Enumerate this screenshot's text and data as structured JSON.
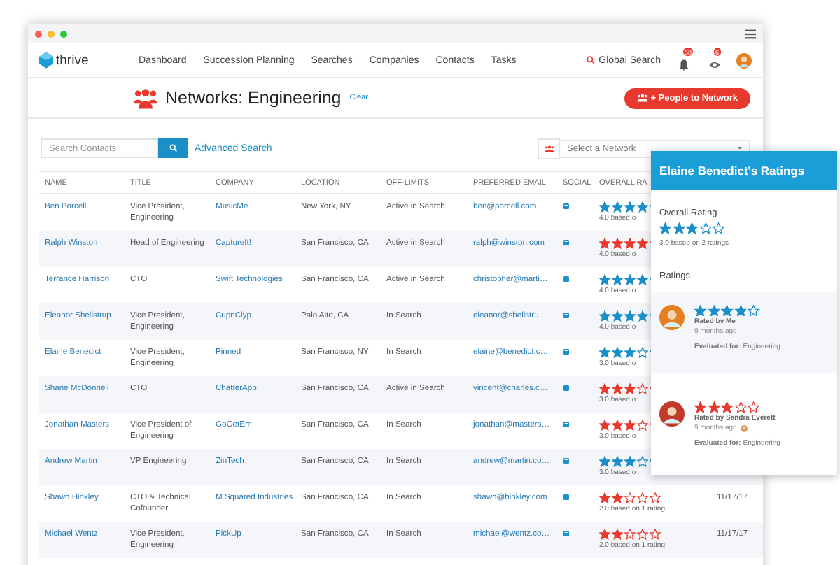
{
  "nav": {
    "logo": "thrive",
    "links": [
      "Dashboard",
      "Succession Planning",
      "Searches",
      "Companies",
      "Contacts",
      "Tasks"
    ],
    "global_search": "Global Search",
    "badges": [
      "58",
      "6"
    ]
  },
  "header": {
    "title": "Networks: Engineering",
    "clear": "Clear",
    "add_button": "+ People to Network"
  },
  "search": {
    "placeholder": "Search Contacts",
    "advanced": "Advanced Search"
  },
  "network_select": {
    "placeholder": "Select a Network"
  },
  "table": {
    "columns": [
      "NAME",
      "TITLE",
      "COMPANY",
      "LOCATION",
      "OFF-LIMITS",
      "PREFERRED EMAIL",
      "SOCIAL",
      "OVERALL RA"
    ],
    "rows": [
      {
        "name": "Ben Porcell",
        "title": "Vice President, Engineering",
        "company": "MusicMe",
        "location": "New York, NY",
        "off_limits": "Active in Search",
        "email": "ben@porcell.com",
        "stars": 4,
        "color": "#1a8fc9",
        "rating": "4.0 based o"
      },
      {
        "name": "Ralph Winston",
        "title": "Head of Engineering",
        "company": "CaptureIt!",
        "location": "San Francisco, CA",
        "off_limits": "Active in Search",
        "email": "ralph@winston.com",
        "stars": 4,
        "color": "#e8392f",
        "rating": "4.0 based o"
      },
      {
        "name": "Terrance Harrison",
        "title": "CTO",
        "company": "Swift Technologies",
        "location": "San Francisco, CA",
        "off_limits": "Active in Search",
        "email": "christopher@marti…",
        "stars": 4,
        "color": "#1a8fc9",
        "rating": "4.0 based o"
      },
      {
        "name": "Eleanor Shellstrup",
        "title": "Vice President, Engineering",
        "company": "CupnClyp",
        "location": "Palo Alto, CA",
        "off_limits": "In Search",
        "email": "eleanor@shellstru…",
        "stars": 4,
        "color": "#1a8fc9",
        "rating": "4.0 based o"
      },
      {
        "name": "Elaine Benedict",
        "title": "Vice President, Engineering",
        "company": "Pinned",
        "location": "San Francisco, NY",
        "off_limits": "In Search",
        "email": "elaine@benedict.c…",
        "stars": 3,
        "color": "#1a8fc9",
        "rating": "3.0 based o"
      },
      {
        "name": "Shane McDonnell",
        "title": "CTO",
        "company": "ChatterApp",
        "location": "San Francisco, CA",
        "off_limits": "Active in Search",
        "email": "vincent@charles.c…",
        "stars": 3,
        "color": "#e8392f",
        "rating": "3.0 based o"
      },
      {
        "name": "Jonathan Masters",
        "title": "Vice President of Engineering",
        "company": "GoGetEm",
        "location": "San Francisco, CA",
        "off_limits": "In Search",
        "email": "jonathan@masters…",
        "stars": 3,
        "color": "#e8392f",
        "rating": "3.0 based o"
      },
      {
        "name": "Andrew Martin",
        "title": "VP Engineering",
        "company": "ZinTech",
        "location": "San Francisco, CA",
        "off_limits": "In Search",
        "email": "andrew@martin.co…",
        "stars": 3,
        "color": "#1a8fc9",
        "rating": "3.0 based o"
      },
      {
        "name": "Shawn Hinkley",
        "title": "CTO & Technical Cofounder",
        "company": "M Squared Industries",
        "location": "San Francisco, CA",
        "off_limits": "In Search",
        "email": "shawn@hinkley.com",
        "stars": 2,
        "color": "#e8392f",
        "rating": "2.0 based on 1 rating",
        "date": "11/17/17"
      },
      {
        "name": "Michael Wentz",
        "title": "Vice President, Engineering",
        "company": "PickUp",
        "location": "San Francisco, CA",
        "off_limits": "In Search",
        "email": "michael@wentz.co…",
        "stars": 2,
        "color": "#e8392f",
        "rating": "2.0 based on 1 rating",
        "date": "11/17/17"
      }
    ]
  },
  "ratings_panel": {
    "title": "Elaine Benedict's Ratings",
    "overall_label": "Overall Rating",
    "overall": {
      "stars": 3,
      "text": "3.0 based on 2 ratings"
    },
    "ratings_label": "Ratings",
    "ratings": [
      {
        "stars": 4,
        "color": "#1a8fc9",
        "rated_by": "Rated by Me",
        "time": "9 months ago",
        "evaluated": "**Evaluated for:** Engineering",
        "small_avatar": false
      },
      {
        "stars": 3,
        "color": "#e8392f",
        "rated_by": "Rated by Sandra Everett",
        "time": "9 months ago",
        "evaluated": "**Evaluated for:** Engineering",
        "small_avatar": true
      }
    ]
  }
}
